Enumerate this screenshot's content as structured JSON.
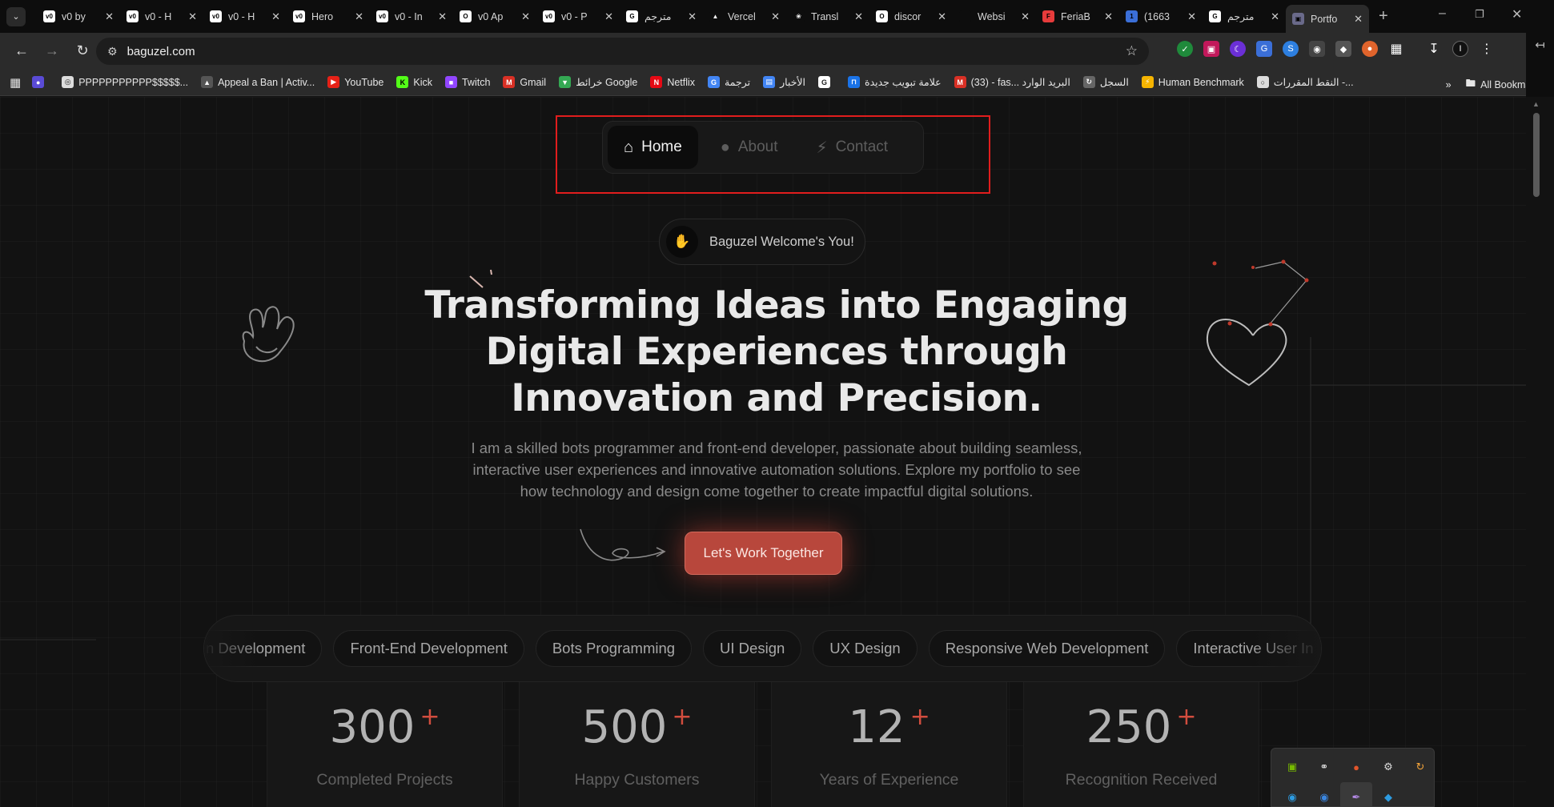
{
  "tabs": [
    {
      "title": "v0 by",
      "favicon": "v0"
    },
    {
      "title": "v0 - H",
      "favicon": "v0"
    },
    {
      "title": "v0 - H",
      "favicon": "v0"
    },
    {
      "title": "Hero",
      "favicon": "v0"
    },
    {
      "title": "v0 - In",
      "favicon": "v0"
    },
    {
      "title": "v0 Ap",
      "favicon": "github"
    },
    {
      "title": "v0 - P",
      "favicon": "v0"
    },
    {
      "title": "مترجم",
      "favicon": "google"
    },
    {
      "title": "Vercel",
      "favicon": "vercel"
    },
    {
      "title": "Transl",
      "favicon": "openai"
    },
    {
      "title": "discor",
      "favicon": "github"
    },
    {
      "title": "Websi",
      "favicon": "blank"
    },
    {
      "title": "FeriaB",
      "favicon": "feria"
    },
    {
      "title": "(1663",
      "favicon": "tiktok"
    },
    {
      "title": "مترجم",
      "favicon": "google"
    },
    {
      "title": "Portfo",
      "favicon": "portfolio",
      "active": true
    }
  ],
  "address": {
    "url": "baguzel.com"
  },
  "bookmarks": [
    {
      "label": "",
      "icon": "circle-badge"
    },
    {
      "label": "PPPPPPPPPPP$$$$$...",
      "icon": "chrome"
    },
    {
      "label": "Appeal a Ban | Activ...",
      "icon": "triangle"
    },
    {
      "label": "YouTube",
      "icon": "youtube"
    },
    {
      "label": "Kick",
      "icon": "kick"
    },
    {
      "label": "Twitch",
      "icon": "twitch"
    },
    {
      "label": "Gmail",
      "icon": "gmail"
    },
    {
      "label": "خرائط Google",
      "icon": "maps"
    },
    {
      "label": "Netflix",
      "icon": "netflix"
    },
    {
      "label": "ترجمة",
      "icon": "translate"
    },
    {
      "label": "الأخبار",
      "icon": "news"
    },
    {
      "label": "",
      "icon": "google"
    },
    {
      "label": "علامة تبويب جديدة",
      "icon": "bracket"
    },
    {
      "label": "(33) - fas... البريد الوارد",
      "icon": "gmail"
    },
    {
      "label": "السجل",
      "icon": "history"
    },
    {
      "label": "Human Benchmark",
      "icon": "bolt"
    },
    {
      "label": "النقط المقررات -...",
      "icon": "globe"
    }
  ],
  "all_bookmarks_label": "All Bookmarks",
  "nav": {
    "items": [
      {
        "label": "Home",
        "icon": "home-icon",
        "active": true
      },
      {
        "label": "About",
        "icon": "user-icon"
      },
      {
        "label": "Contact",
        "icon": "bolt-icon"
      }
    ]
  },
  "hero": {
    "welcome": "Baguzel Welcome's You!",
    "headline_lines": [
      "Transforming Ideas into Engaging",
      "Digital Experiences through",
      "Innovation and Precision."
    ],
    "sub_lines": [
      "I am a skilled bots programmer and front-end developer, passionate about building seamless,",
      "interactive user experiences and innovative automation solutions. Explore my portfolio to see",
      "how technology and design come together to create impactful digital solutions."
    ],
    "cta": "Let's Work Together"
  },
  "skills": [
    "n Development",
    "Front-End Development",
    "Bots Programming",
    "UI Design",
    "UX Design",
    "Responsive Web Development",
    "Interactive User In"
  ],
  "stats": [
    {
      "value": "300",
      "label": "Completed Projects"
    },
    {
      "value": "500",
      "label": "Happy Customers"
    },
    {
      "value": "12",
      "label": "Years of Experience"
    },
    {
      "value": "250",
      "label": "Recognition Received"
    }
  ],
  "stat_suffix": "+",
  "colors": {
    "accent": "#b8473c",
    "highlight": "#e11d1d",
    "background": "#121212"
  }
}
